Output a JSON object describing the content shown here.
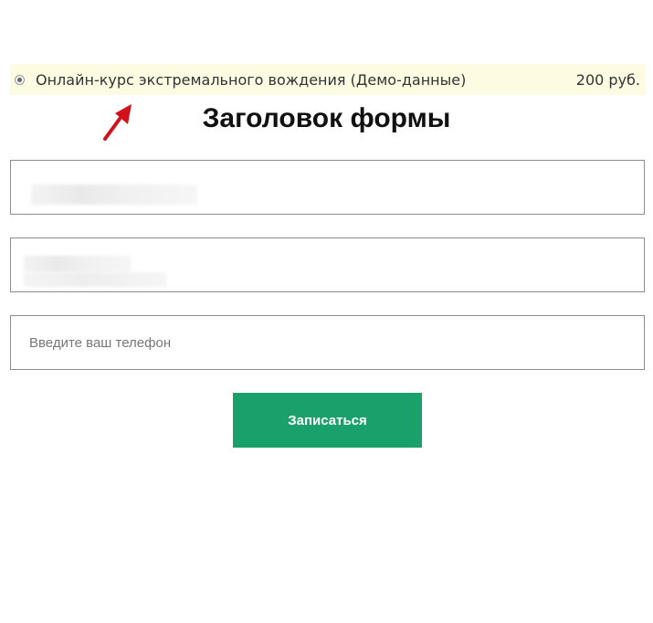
{
  "product": {
    "name": "Онлайн-курс экстремального вождения (Демо-данные)",
    "price": "200 руб.",
    "selected": true,
    "highlight_color": "#fdfbe2"
  },
  "annotation": {
    "icon": "red-arrow-icon",
    "color": "#d0121b"
  },
  "form": {
    "title": "Заголовок формы",
    "fields": [
      {
        "name": "name",
        "value": "",
        "placeholder": "",
        "obscured": true
      },
      {
        "name": "email",
        "value": "",
        "placeholder": "",
        "obscured": true
      },
      {
        "name": "phone",
        "value": "",
        "placeholder": "Введите ваш телефон",
        "obscured": false
      }
    ],
    "submit_label": "Записаться",
    "submit_color": "#1aa06a"
  }
}
